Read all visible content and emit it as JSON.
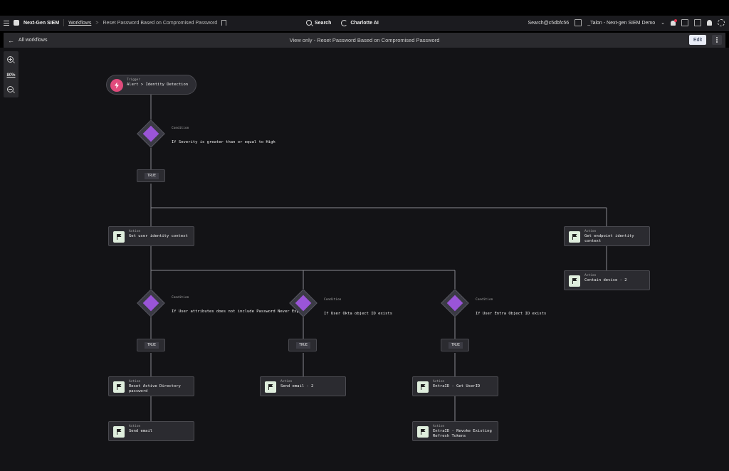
{
  "topbar": {
    "brand": "Next-Gen SIEM",
    "breadcrumb_link": "Workflows",
    "breadcrumb_sep": ">",
    "breadcrumb_current": "Reset Password Based on Compromised Password",
    "search_label": "Search",
    "charlotte_label": "Charlotte AI",
    "search_id": "Search@c5dbfc56",
    "tenant": "_Talon - Next-gen SIEM Demo"
  },
  "subbar": {
    "back_label": "All workflows",
    "title": "View only - Reset Password Based on Compromised Password",
    "edit_label": "Edit"
  },
  "zoom": {
    "level": "80%"
  },
  "workflow": {
    "trigger": {
      "type": "Trigger",
      "label": "Alert > Identity Detection"
    },
    "condition_1": {
      "type": "Condition",
      "label": "If Severity is greater than or equal to High"
    },
    "condition_2": {
      "type": "Condition",
      "label": "If User attributes does not include Password Never Expires"
    },
    "condition_3": {
      "type": "Condition",
      "label": "If User Okta object ID exists"
    },
    "condition_4": {
      "type": "Condition",
      "label": "If User Entra Object ID exists"
    },
    "true_label": "TRUE",
    "actions": {
      "get_user_identity": {
        "type": "Action",
        "label": "Get user identity context"
      },
      "get_endpoint_identity": {
        "type": "Action",
        "label": "Get endpoint identity context"
      },
      "contain_device": {
        "type": "Action",
        "label": "Contain device - 2"
      },
      "reset_ad_password": {
        "type": "Action",
        "label": "Reset Active Directory password"
      },
      "send_email": {
        "type": "Action",
        "label": "Send email"
      },
      "send_email_2": {
        "type": "Action",
        "label": "Send email - 2"
      },
      "entra_get_userid": {
        "type": "Action",
        "label": "EntraID - Get UserID"
      },
      "entra_revoke": {
        "type": "Action",
        "label": "EntraID - Revoke Existing Refresh Tokens"
      }
    }
  },
  "colors": {
    "trigger_icon": "#e04b7c",
    "condition_icon": "#9a55d8",
    "action_icon_bg": "#dfeedd",
    "edit_button": "#e9edf7"
  }
}
